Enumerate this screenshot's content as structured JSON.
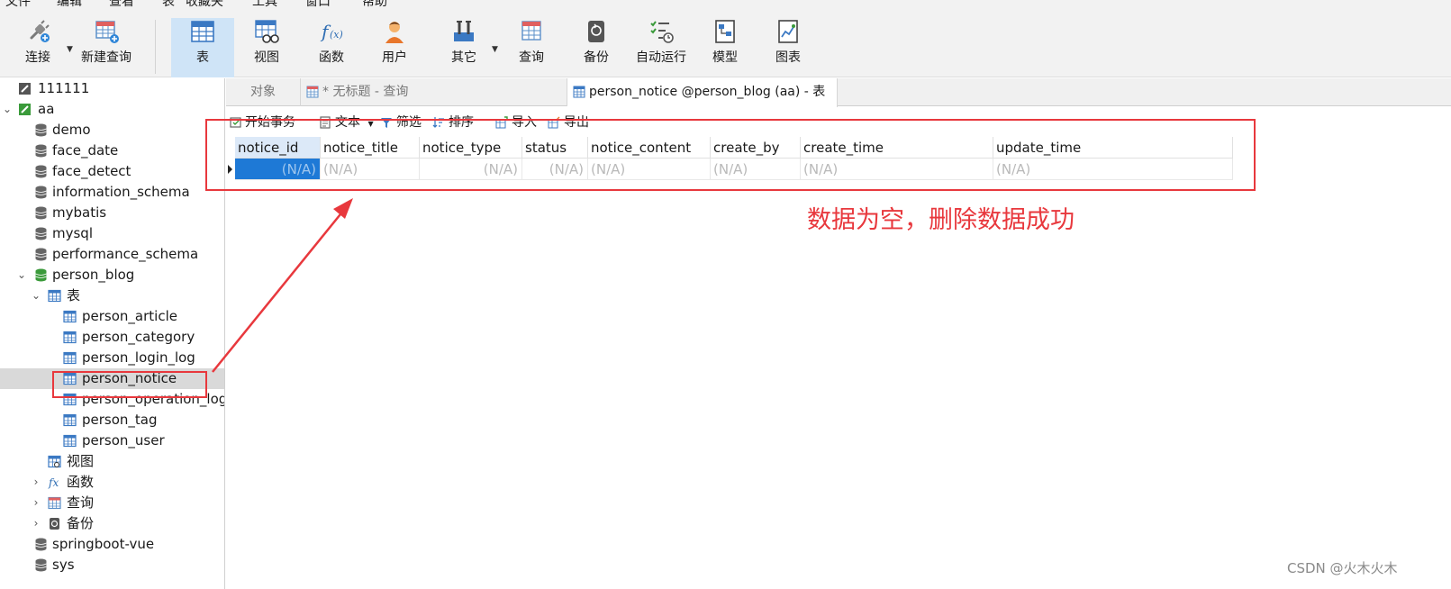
{
  "menu": [
    "文件",
    "编辑",
    "查看",
    "表",
    "收藏夹",
    "工具",
    "窗口",
    "帮助"
  ],
  "toolbar": {
    "connect": "连接",
    "new_query": "新建查询",
    "table": "表",
    "view": "视图",
    "function": "函数",
    "user": "用户",
    "other": "其它",
    "query": "查询",
    "backup": "备份",
    "automation": "自动运行",
    "model": "模型",
    "chart": "图表",
    "active": "表"
  },
  "tree": {
    "connection_1": "111111",
    "connection_2": "aa",
    "databases": [
      "demo",
      "face_date",
      "face_detect",
      "information_schema",
      "mybatis",
      "mysql",
      "performance_schema",
      "person_blog"
    ],
    "tables_folder": "表",
    "tables": [
      "person_article",
      "person_category",
      "person_login_log",
      "person_notice",
      "person_operation_log",
      "person_tag",
      "person_user"
    ],
    "selected_table": "person_notice",
    "folders": [
      "视图",
      "函数",
      "查询",
      "备份"
    ],
    "more_databases": [
      "springboot-vue",
      "sys"
    ]
  },
  "tabs": {
    "objects": "对象",
    "untitled_query": "* 无标题 - 查询",
    "active_table": "person_notice @person_blog (aa) - 表"
  },
  "grid_toolbar": {
    "begin_transaction": "开始事务",
    "text": "文本",
    "filter": "筛选",
    "sort": "排序",
    "import": "导入",
    "export": "导出"
  },
  "grid": {
    "columns": [
      "notice_id",
      "notice_title",
      "notice_type",
      "status",
      "notice_content",
      "create_by",
      "create_time",
      "update_time"
    ],
    "row": [
      "(N/A)",
      "(N/A)",
      "(N/A)",
      "(N/A)",
      "(N/A)",
      "(N/A)",
      "(N/A)",
      "(N/A)"
    ]
  },
  "annotation": {
    "note": "数据为空，删除数据成功",
    "color": "#e8383d"
  },
  "watermark": "CSDN @火木火木",
  "colors": {
    "selection_blue": "#1e79d6",
    "toolbar_active": "#cfe4f7",
    "tree_selected": "#d9d9d9"
  }
}
